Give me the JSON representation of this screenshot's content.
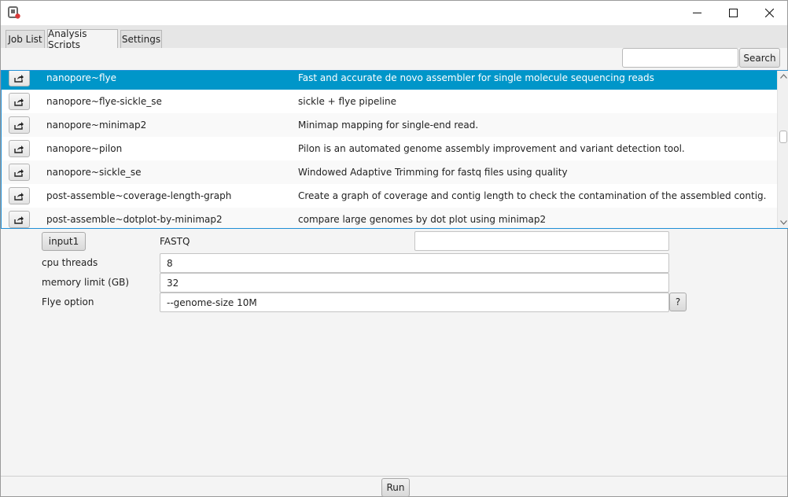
{
  "window": {
    "minimize_glyph": "—",
    "maximize_glyph": "☐",
    "close_glyph": "✕",
    "app_icon": "app-logo-icon"
  },
  "tabs": [
    {
      "label": "Job List",
      "active": false
    },
    {
      "label": "Analysis Scripts",
      "active": true
    },
    {
      "label": "Settings",
      "active": false
    }
  ],
  "search": {
    "value": "",
    "placeholder": "",
    "button_label": "Search"
  },
  "scripts": [
    {
      "name": "nanopore~flye",
      "description": "Fast and accurate de novo assembler for single molecule sequencing reads",
      "selected": true
    },
    {
      "name": "nanopore~flye-sickle_se",
      "description": "sickle + flye pipeline",
      "selected": false
    },
    {
      "name": "nanopore~minimap2",
      "description": "Minimap mapping for single-end read.",
      "selected": false
    },
    {
      "name": "nanopore~pilon",
      "description": "Pilon is an automated genome assembly improvement and variant detection tool.",
      "selected": false
    },
    {
      "name": "nanopore~sickle_se",
      "description": "Windowed Adaptive Trimming for fastq files using quality",
      "selected": false
    },
    {
      "name": "post-assemble~coverage-length-graph",
      "description": "Create a graph of coverage and contig length to check the contamination of the assembled contig.",
      "selected": false
    },
    {
      "name": "post-assemble~dotplot-by-minimap2",
      "description": "compare large genomes by dot plot using minimap2",
      "selected": false
    }
  ],
  "params": {
    "input_button_label": "input1",
    "input_type": "FASTQ",
    "input_value": "",
    "cpu_label": "cpu threads",
    "cpu_value": "8",
    "memory_label": "memory limit (GB)",
    "memory_value": "32",
    "option_label": "Flye option",
    "option_value": "--genome-size 10M",
    "help_label": "?"
  },
  "footer": {
    "run_label": "Run"
  },
  "colors": {
    "selection": "#0096c9",
    "list_border": "#1f8fd6"
  }
}
